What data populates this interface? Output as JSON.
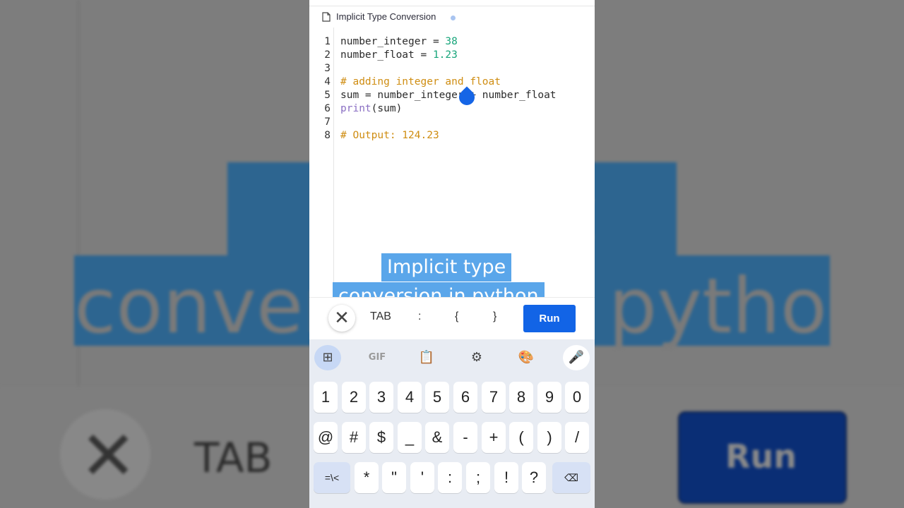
{
  "app": {
    "file_tab_title": "Implicit Type Conversion"
  },
  "editor": {
    "line_numbers": [
      "1",
      "2",
      "3",
      "4",
      "5",
      "6",
      "7",
      "8"
    ],
    "lines": [
      {
        "segments": [
          {
            "t": "number_integer = ",
            "c": "plain"
          },
          {
            "t": "38",
            "c": "num"
          }
        ]
      },
      {
        "segments": [
          {
            "t": "number_float = ",
            "c": "plain"
          },
          {
            "t": "1.23",
            "c": "num"
          }
        ]
      },
      {
        "segments": []
      },
      {
        "segments": [
          {
            "t": "# adding integer and float",
            "c": "cmt"
          }
        ]
      },
      {
        "segments": [
          {
            "t": "sum = number_integer + number_float",
            "c": "plain"
          }
        ]
      },
      {
        "segments": [
          {
            "t": "print",
            "c": "fn"
          },
          {
            "t": "(sum)",
            "c": "plain"
          }
        ]
      },
      {
        "segments": []
      },
      {
        "segments": [
          {
            "t": "# Output: 124.23",
            "c": "cmt"
          }
        ]
      }
    ]
  },
  "caption": {
    "line1": "Implicit type",
    "line2": "conversion in python"
  },
  "toolbar": {
    "close_icon": "close-icon",
    "tab_key": "TAB",
    "colon_key": ":",
    "open_brace_key": "{",
    "close_brace_key": "}",
    "run_label": "Run"
  },
  "keyboard": {
    "top_row": [
      {
        "name": "apps-grid-icon",
        "glyph": "⊞"
      },
      {
        "name": "gif-icon",
        "glyph": "GIF"
      },
      {
        "name": "clipboard-icon",
        "glyph": "📋"
      },
      {
        "name": "gear-icon",
        "glyph": "⚙"
      },
      {
        "name": "palette-icon",
        "glyph": "🎨"
      },
      {
        "name": "microphone-icon",
        "glyph": "🎤"
      }
    ],
    "row1": [
      "1",
      "2",
      "3",
      "4",
      "5",
      "6",
      "7",
      "8",
      "9",
      "0"
    ],
    "row2": [
      "@",
      "#",
      "$",
      "_",
      "&",
      "-",
      "+",
      "(",
      ")",
      "/"
    ],
    "row3": [
      "=\\<",
      "*",
      "\"",
      "'",
      ":",
      ";",
      "!",
      "?",
      "⌫"
    ]
  },
  "background": {
    "caption_line1": "Implicit type",
    "caption_line2": "conversion in python",
    "tab_label": "TAB",
    "run_label": "Run"
  },
  "colors": {
    "accent_blue": "#1264e6",
    "caption_blue": "#5aa6ea",
    "number_green": "#17a57a",
    "comment_orange": "#cf8d12",
    "builtin_purple": "#8a6fc3"
  }
}
